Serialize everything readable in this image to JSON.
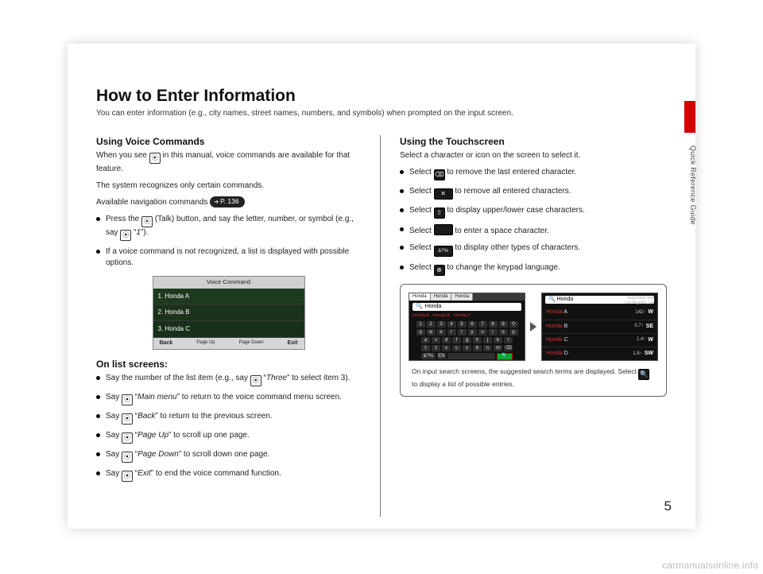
{
  "side_label": "Quick Reference Guide",
  "page_number": "5",
  "watermark": "carmanualsonline.info",
  "title": "How to Enter Information",
  "intro": "You can enter information (e.g., city names, street names, numbers, and symbols) when prompted on the input screen.",
  "left": {
    "h_voice": "Using Voice Commands",
    "voice_p1a": "When you see ",
    "voice_p1b": " in this manual, voice commands are available for that feature.",
    "voice_p2": "The system recognizes only certain commands.",
    "voice_p3": "Available navigation commands ",
    "pill": "P. 136",
    "bul1a": "Press the ",
    "bul1b": " (Talk) button, and say the letter, number, or symbol (e.g., say ",
    "bul1c": " “",
    "bul1_cmd": "1",
    "bul1d": "”).",
    "bul2": "If a voice command is not recognized, a list is displayed with possible options.",
    "vc_title": "Voice Command",
    "vc_items": [
      "1. Honda A",
      "2. Honda B",
      "3. Honda C"
    ],
    "vc_foot": [
      "Back",
      "Page\nUp",
      "Page\nDown",
      "Exit"
    ],
    "h_list": "On list screens:",
    "l1a": "Say the number of the list item (e.g., say ",
    "l1b": " “",
    "l1_cmd": "Three",
    "l1c": "” to select item 3).",
    "l2a": "Say ",
    "l2b": " “",
    "l2_cmd": "Main menu",
    "l2c": "” to return to the voice command menu screen.",
    "l3a": "Say ",
    "l3b": " “",
    "l3_cmd": "Back",
    "l3c": "” to return to the previous screen.",
    "l4a": "Say ",
    "l4b": " “",
    "l4_cmd": "Page Up",
    "l4c": "” to scroll up one page.",
    "l5a": "Say ",
    "l5b": " “",
    "l5_cmd": "Page Down",
    "l5c": "” to scroll down one page.",
    "l6a": "Say ",
    "l6b": " “",
    "l6_cmd": "Exit",
    "l6c": "” to end the voice command function."
  },
  "right": {
    "h_touch": "Using the Touchscreen",
    "t_p1": "Select a character or icon on the screen to select it.",
    "t1a": "Select ",
    "t1b": " to remove the last entered character.",
    "t2a": "Select ",
    "t2b": " to remove all entered characters.",
    "t3a": "Select ",
    "t3b": " to display upper/lower case characters.",
    "t4a": "Select ",
    "t4b": " to enter a space character.",
    "t5a": "Select ",
    "t5b": " to display other types of characters.",
    "t6a": "Select ",
    "t6b": " to change the keypad language.",
    "kb": {
      "tabs": [
        "Honda",
        "Honda",
        "Honda"
      ],
      "field": "Honda",
      "crumbs_a": "Honda A",
      "crumbs_b": "Honda B",
      "crumbs_c": "Honda C",
      "rows": [
        [
          "1",
          "2",
          "3",
          "4",
          "5",
          "6",
          "7",
          "8",
          "9",
          "0"
        ],
        [
          "q",
          "w",
          "e",
          "r",
          "t",
          "y",
          "u",
          "i",
          "o",
          "p"
        ],
        [
          "a",
          "s",
          "d",
          "f",
          "g",
          "h",
          "j",
          "k",
          "l"
        ],
        [
          "⇧",
          "z",
          "x",
          "c",
          "v",
          "b",
          "n",
          "m",
          "⌫"
        ]
      ],
      "bottom": [
        "&?%",
        "EN",
        "␣",
        "🔍"
      ]
    },
    "list": {
      "field": "Honda",
      "note_l1": "Searching near",
      "note_l2": "Los Angeles, CA",
      "rows": [
        {
          "name_hl": "Honda",
          "suffix": " A",
          "dist": "142↑",
          "dir": "W"
        },
        {
          "name_hl": "Honda",
          "suffix": " B",
          "dist": "0.7↑",
          "dir": "SE"
        },
        {
          "name_hl": "Honda",
          "suffix": " C",
          "dist": "1.4↑",
          "dir": "W"
        },
        {
          "name_hl": "Honda",
          "suffix": " D",
          "dist": "1.8↑",
          "dir": "SW"
        }
      ]
    },
    "caption_a": "On input search screens, the suggested search terms are displayed. Select ",
    "caption_b": " to display a list of possible entries."
  },
  "icons": {
    "talk": "⦿",
    "delete": "⌫",
    "clear_wide": "✕",
    "shift": "⇧",
    "space": " ",
    "symbols": "&?%",
    "globe": "⊕",
    "search": "🔍"
  }
}
